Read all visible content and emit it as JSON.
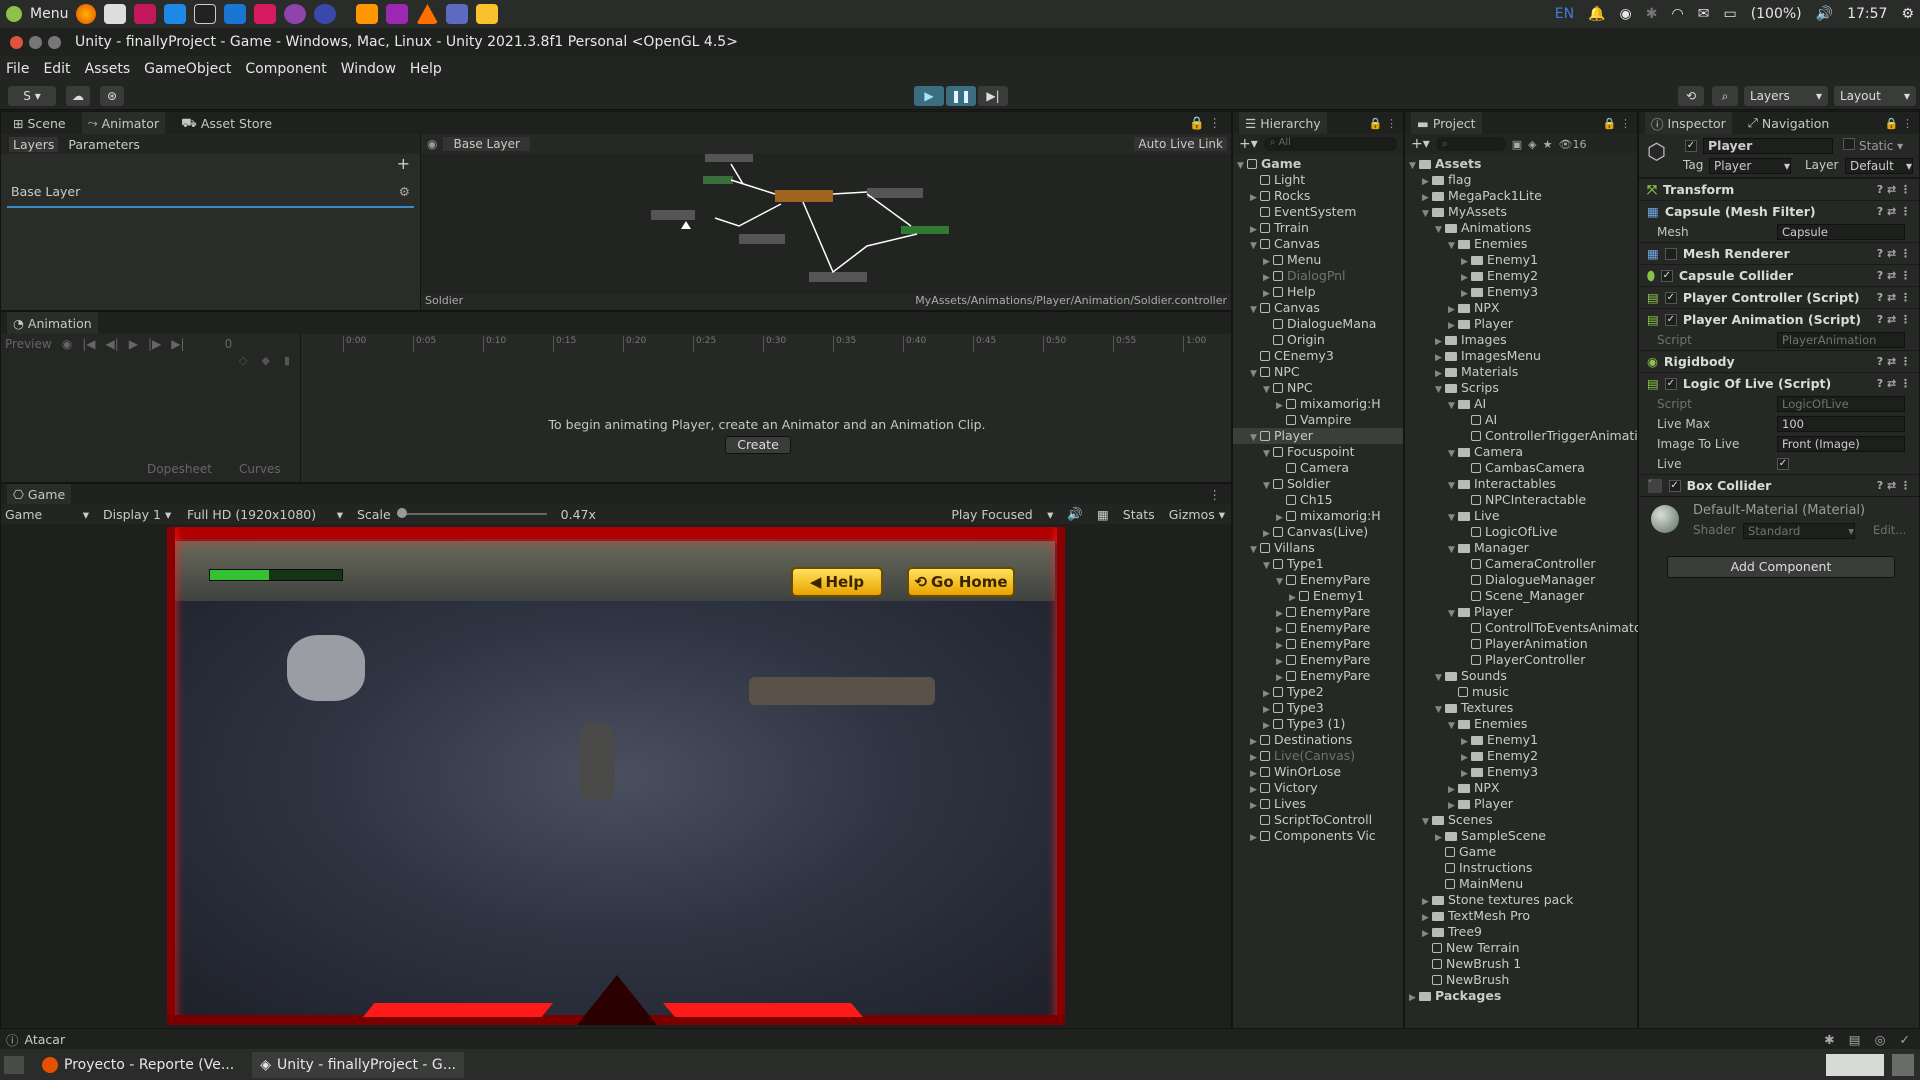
{
  "sys": {
    "menu": "Menu",
    "lang": "EN",
    "battery": "(100%)",
    "time": "17:57"
  },
  "title": "Unity - finallyProject - Game - Windows, Mac, Linux - Unity 2021.3.8f1 Personal <OpenGL 4.5>",
  "menus": [
    "File",
    "Edit",
    "Assets",
    "GameObject",
    "Component",
    "Window",
    "Help"
  ],
  "toolbar": {
    "account": "S",
    "layers": "Layers",
    "layout": "Layout"
  },
  "animator": {
    "tabs": [
      "Scene",
      "Animator",
      "Asset Store"
    ],
    "subtabs": [
      "Layers",
      "Parameters"
    ],
    "layer": "Base Layer",
    "breadcrumb": "Base Layer",
    "autolive": "Auto Live Link",
    "footer_left": "Soldier",
    "footer_right": "MyAssets/Animations/Player/Animation/Soldier.controller"
  },
  "animation": {
    "tab": "Animation",
    "preview": "Preview",
    "frame": "0",
    "ticks": [
      "0:00",
      "0:05",
      "0:10",
      "0:15",
      "0:20",
      "0:25",
      "0:30",
      "0:35",
      "0:40",
      "0:45",
      "0:50",
      "0:55",
      "1:00"
    ],
    "message": "To begin animating Player, create an Animator and an Animation Clip.",
    "create": "Create",
    "dopesheet": "Dopesheet",
    "curves": "Curves"
  },
  "game": {
    "tab": "Game",
    "mode": "Game",
    "display": "Display 1",
    "resolution": "Full HD (1920x1080)",
    "scale_label": "Scale",
    "scale": "0.47x",
    "play": "Play Focused",
    "stats": "Stats",
    "gizmos": "Gizmos",
    "help_btn": "Help",
    "home_btn": "Go Home",
    "health": 0.45
  },
  "hierarchy": {
    "tab": "Hierarchy",
    "search": "All",
    "rows": [
      {
        "t": "Game",
        "d": 0,
        "a": "▼",
        "root": true
      },
      {
        "t": "Light",
        "d": 1,
        "a": ""
      },
      {
        "t": "Rocks",
        "d": 1,
        "a": "▶"
      },
      {
        "t": "EventSystem",
        "d": 1,
        "a": ""
      },
      {
        "t": "Trrain",
        "d": 1,
        "a": "▶"
      },
      {
        "t": "Canvas",
        "d": 1,
        "a": "▼"
      },
      {
        "t": "Menu",
        "d": 2,
        "a": "▶"
      },
      {
        "t": "DialogPnl",
        "d": 2,
        "a": "▶",
        "dim": true
      },
      {
        "t": "Help",
        "d": 2,
        "a": "▶"
      },
      {
        "t": "Canvas",
        "d": 1,
        "a": "▼"
      },
      {
        "t": "DialogueMana",
        "d": 2,
        "a": ""
      },
      {
        "t": "Origin",
        "d": 2,
        "a": ""
      },
      {
        "t": "CEnemy3",
        "d": 1,
        "a": ""
      },
      {
        "t": "NPC",
        "d": 1,
        "a": "▼"
      },
      {
        "t": "NPC",
        "d": 2,
        "a": "▼"
      },
      {
        "t": "mixamorig:H",
        "d": 3,
        "a": "▶"
      },
      {
        "t": "Vampire",
        "d": 3,
        "a": ""
      },
      {
        "t": "Player",
        "d": 1,
        "a": "▼",
        "sel": true
      },
      {
        "t": "Focuspoint",
        "d": 2,
        "a": "▼"
      },
      {
        "t": "Camera",
        "d": 3,
        "a": ""
      },
      {
        "t": "Soldier",
        "d": 2,
        "a": "▼"
      },
      {
        "t": "Ch15",
        "d": 3,
        "a": ""
      },
      {
        "t": "mixamorig:H",
        "d": 3,
        "a": "▶"
      },
      {
        "t": "Canvas(Live)",
        "d": 2,
        "a": "▶"
      },
      {
        "t": "Villans",
        "d": 1,
        "a": "▼"
      },
      {
        "t": "Type1",
        "d": 2,
        "a": "▼"
      },
      {
        "t": "EnemyPare",
        "d": 3,
        "a": "▼"
      },
      {
        "t": "Enemy1",
        "d": 4,
        "a": "▶"
      },
      {
        "t": "EnemyPare",
        "d": 3,
        "a": "▶"
      },
      {
        "t": "EnemyPare",
        "d": 3,
        "a": "▶"
      },
      {
        "t": "EnemyPare",
        "d": 3,
        "a": "▶"
      },
      {
        "t": "EnemyPare",
        "d": 3,
        "a": "▶"
      },
      {
        "t": "EnemyPare",
        "d": 3,
        "a": "▶"
      },
      {
        "t": "Type2",
        "d": 2,
        "a": "▶"
      },
      {
        "t": "Type3",
        "d": 2,
        "a": "▶"
      },
      {
        "t": "Type3 (1)",
        "d": 2,
        "a": "▶"
      },
      {
        "t": "Destinations",
        "d": 1,
        "a": "▶"
      },
      {
        "t": "Live(Canvas)",
        "d": 1,
        "a": "▶",
        "dim": true
      },
      {
        "t": "WinOrLose",
        "d": 1,
        "a": "▶"
      },
      {
        "t": "Victory",
        "d": 1,
        "a": "▶"
      },
      {
        "t": "Lives",
        "d": 1,
        "a": "▶"
      },
      {
        "t": "ScriptToControll",
        "d": 1,
        "a": ""
      },
      {
        "t": "Components Vic",
        "d": 1,
        "a": "▶"
      }
    ]
  },
  "project": {
    "tab": "Project",
    "count": "16",
    "rows": [
      {
        "t": "Assets",
        "d": 0,
        "a": "▼",
        "f": 1,
        "b": 1
      },
      {
        "t": "flag",
        "d": 1,
        "a": "▶",
        "f": 1
      },
      {
        "t": "MegaPack1Lite",
        "d": 1,
        "a": "▶",
        "f": 1
      },
      {
        "t": "MyAssets",
        "d": 1,
        "a": "▼",
        "f": 1
      },
      {
        "t": "Animations",
        "d": 2,
        "a": "▼",
        "f": 1
      },
      {
        "t": "Enemies",
        "d": 3,
        "a": "▼",
        "f": 1
      },
      {
        "t": "Enemy1",
        "d": 4,
        "a": "▶",
        "f": 1
      },
      {
        "t": "Enemy2",
        "d": 4,
        "a": "▶",
        "f": 1
      },
      {
        "t": "Enemy3",
        "d": 4,
        "a": "▶",
        "f": 1
      },
      {
        "t": "NPX",
        "d": 3,
        "a": "▶",
        "f": 1
      },
      {
        "t": "Player",
        "d": 3,
        "a": "▶",
        "f": 1
      },
      {
        "t": "Images",
        "d": 2,
        "a": "▶",
        "f": 1
      },
      {
        "t": "ImagesMenu",
        "d": 2,
        "a": "▶",
        "f": 1
      },
      {
        "t": "Materials",
        "d": 2,
        "a": "▶",
        "f": 1
      },
      {
        "t": "Scrips",
        "d": 2,
        "a": "▼",
        "f": 1
      },
      {
        "t": "AI",
        "d": 3,
        "a": "▼",
        "f": 1
      },
      {
        "t": "AI",
        "d": 4,
        "a": "",
        "f": 0
      },
      {
        "t": "ControllerTriggerAnimati",
        "d": 4,
        "a": "",
        "f": 0
      },
      {
        "t": "Camera",
        "d": 3,
        "a": "▼",
        "f": 1
      },
      {
        "t": "CambasCamera",
        "d": 4,
        "a": "",
        "f": 0
      },
      {
        "t": "Interactables",
        "d": 3,
        "a": "▼",
        "f": 1
      },
      {
        "t": "NPCInteractable",
        "d": 4,
        "a": "",
        "f": 0
      },
      {
        "t": "Live",
        "d": 3,
        "a": "▼",
        "f": 1
      },
      {
        "t": "LogicOfLive",
        "d": 4,
        "a": "",
        "f": 0
      },
      {
        "t": "Manager",
        "d": 3,
        "a": "▼",
        "f": 1
      },
      {
        "t": "CameraController",
        "d": 4,
        "a": "",
        "f": 0
      },
      {
        "t": "DialogueManager",
        "d": 4,
        "a": "",
        "f": 0
      },
      {
        "t": "Scene_Manager",
        "d": 4,
        "a": "",
        "f": 0
      },
      {
        "t": "Player",
        "d": 3,
        "a": "▼",
        "f": 1
      },
      {
        "t": "ControllToEventsAnimatc",
        "d": 4,
        "a": "",
        "f": 0
      },
      {
        "t": "PlayerAnimation",
        "d": 4,
        "a": "",
        "f": 0
      },
      {
        "t": "PlayerController",
        "d": 4,
        "a": "",
        "f": 0
      },
      {
        "t": "Sounds",
        "d": 2,
        "a": "▼",
        "f": 1
      },
      {
        "t": "music",
        "d": 3,
        "a": "",
        "f": 0
      },
      {
        "t": "Textures",
        "d": 2,
        "a": "▼",
        "f": 1
      },
      {
        "t": "Enemies",
        "d": 3,
        "a": "▼",
        "f": 1
      },
      {
        "t": "Enemy1",
        "d": 4,
        "a": "▶",
        "f": 1
      },
      {
        "t": "Enemy2",
        "d": 4,
        "a": "▶",
        "f": 1
      },
      {
        "t": "Enemy3",
        "d": 4,
        "a": "▶",
        "f": 1
      },
      {
        "t": "NPX",
        "d": 3,
        "a": "▶",
        "f": 1
      },
      {
        "t": "Player",
        "d": 3,
        "a": "▶",
        "f": 1
      },
      {
        "t": "Scenes",
        "d": 1,
        "a": "▼",
        "f": 1
      },
      {
        "t": "SampleScene",
        "d": 2,
        "a": "▶",
        "f": 1
      },
      {
        "t": "Game",
        "d": 2,
        "a": "",
        "f": 0
      },
      {
        "t": "Instructions",
        "d": 2,
        "a": "",
        "f": 0
      },
      {
        "t": "MainMenu",
        "d": 2,
        "a": "",
        "f": 0
      },
      {
        "t": "Stone textures pack",
        "d": 1,
        "a": "▶",
        "f": 1
      },
      {
        "t": "TextMesh Pro",
        "d": 1,
        "a": "▶",
        "f": 1
      },
      {
        "t": "Tree9",
        "d": 1,
        "a": "▶",
        "f": 1
      },
      {
        "t": "New Terrain",
        "d": 1,
        "a": "",
        "f": 0
      },
      {
        "t": "NewBrush 1",
        "d": 1,
        "a": "",
        "f": 0
      },
      {
        "t": "NewBrush",
        "d": 1,
        "a": "",
        "f": 0
      },
      {
        "t": "Packages",
        "d": 0,
        "a": "▶",
        "f": 1,
        "b": 1
      }
    ]
  },
  "inspector": {
    "tabs": [
      "Inspector",
      "Navigation"
    ],
    "name": "Player",
    "static": "Static",
    "tag_label": "Tag",
    "tag": "Player",
    "layer_label": "Layer",
    "layer": "Default",
    "transform": "Transform",
    "meshfilter": "Capsule (Mesh Filter)",
    "mesh_label": "Mesh",
    "mesh": "Capsule",
    "meshrenderer": "Mesh Renderer",
    "capsule": "Capsule Collider",
    "pcontroller": "Player Controller (Script)",
    "panim": "Player Animation (Script)",
    "script_label": "Script",
    "panim_script": "PlayerAnimation",
    "rigidbody": "Rigidbody",
    "logic": "Logic Of Live (Script)",
    "logic_script": "LogicOfLive",
    "livemax_label": "Live Max",
    "livemax": "100",
    "image_label": "Image To Live",
    "image": "Front (Image)",
    "live_label": "Live",
    "box": "Box Collider",
    "material": "Default-Material (Material)",
    "shader_label": "Shader",
    "shader": "Standard",
    "edit": "Edit...",
    "add": "Add Component"
  },
  "status": "Atacar",
  "taskbar": [
    "Proyecto - Reporte (Ve...",
    "Unity - finallyProject - G..."
  ]
}
